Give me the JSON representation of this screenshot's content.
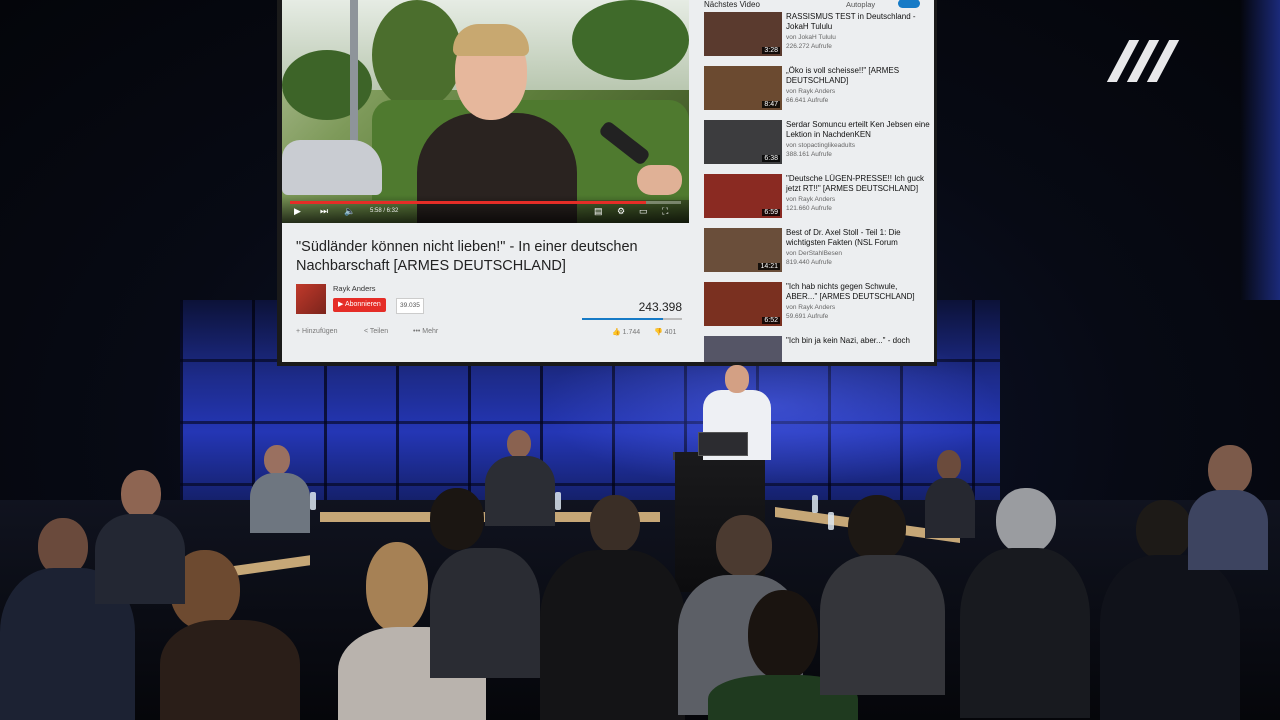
{
  "logo": {
    "name": "broadcaster-logo",
    "glyph": "///"
  },
  "projection": {
    "video": {
      "time": "5:58 / 6:32",
      "progress": 0.91
    },
    "title": "\"Südländer können nicht lieben!\" - In einer deutschen Nachbarschaft [ARMES DEUTSCHLAND]",
    "channel": "Rayk Anders",
    "subscribe_label": "Abonnieren",
    "subscriber_count": "39.035",
    "views": "243.398",
    "like_ratio": 0.81,
    "actions": {
      "add": "Hinzufügen",
      "share": "Teilen",
      "more": "Mehr"
    },
    "likes": "1.744",
    "dislikes": "401",
    "sidebar": {
      "heading": "Nächstes Video",
      "autoplay_label": "Autoplay",
      "autoplay_on": true,
      "items": [
        {
          "title": "RASSISMUS TEST in Deutschland - JokaH Tululu",
          "channel": "von JokaH Tululu",
          "views": "226.272 Aufrufe",
          "duration": "3:28"
        },
        {
          "title": "„Öko is voll scheisse!!\" [ARMES DEUTSCHLAND]",
          "channel": "von Rayk Anders",
          "views": "66.641 Aufrufe",
          "duration": "8:47"
        },
        {
          "title": "Serdar Somuncu erteilt Ken Jebsen eine Lektion in NachdenKEN",
          "channel": "von stopactinglikeadults",
          "views": "388.161 Aufrufe",
          "duration": "6:38"
        },
        {
          "title": "\"Deutsche LÜGEN-PRESSE!! Ich guck jetzt RT!!\" [ARMES DEUTSCHLAND]",
          "channel": "von Rayk Anders",
          "views": "121.660 Aufrufe",
          "duration": "6:59"
        },
        {
          "title": "Best of Dr. Axel Stoll - Teil 1: Die wichtigsten Fakten (NSL Forum",
          "channel": "von DerStahlBesen",
          "views": "819.440 Aufrufe",
          "duration": "14:21"
        },
        {
          "title": "\"Ich hab nichts gegen Schwule, ABER...\" [ARMES DEUTSCHLAND]",
          "channel": "von Rayk Anders",
          "views": "59.691 Aufrufe",
          "duration": "6:52"
        },
        {
          "title": "\"Ich bin ja kein Nazi, aber...\" - doch",
          "channel": "",
          "views": "",
          "duration": ""
        }
      ]
    }
  },
  "colors": {
    "accent_red": "#e52d27",
    "youtube_blue": "#167ac6",
    "wall_blue": "#2436b5"
  }
}
